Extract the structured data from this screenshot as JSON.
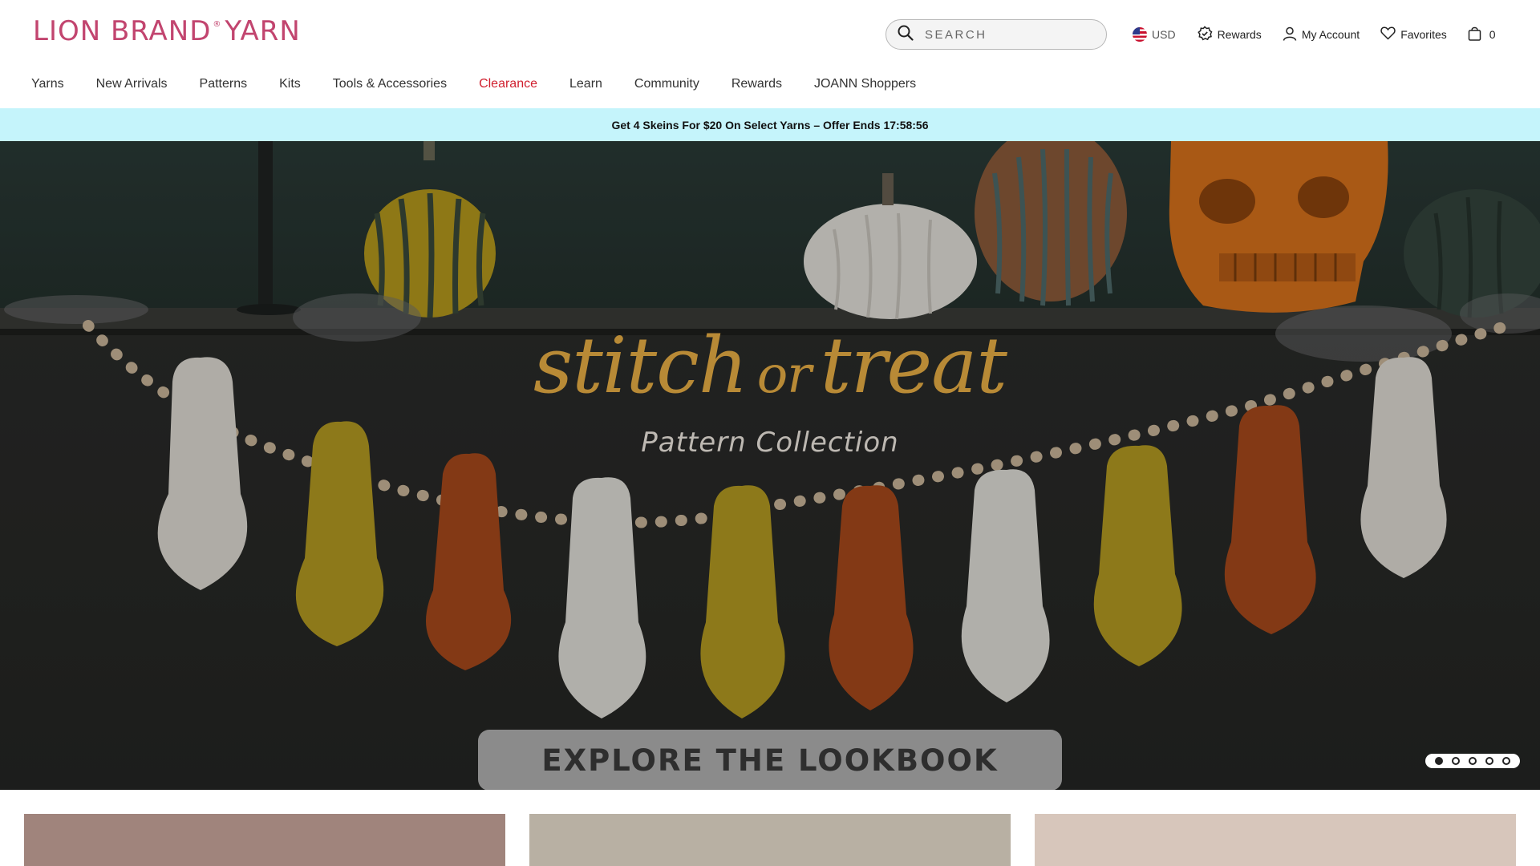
{
  "brand": {
    "logo_text": "LION BRAND",
    "logo_mark": "®",
    "logo_suffix": "YARN",
    "color": "#c2456f"
  },
  "search": {
    "placeholder": "SEARCH",
    "icon": "search-icon"
  },
  "utilities": {
    "currency": {
      "label": "USD",
      "icon": "us-flag-icon"
    },
    "rewards": {
      "label": "Rewards",
      "icon": "rewards-badge-icon"
    },
    "account": {
      "label": "My Account",
      "icon": "user-icon"
    },
    "favorites": {
      "label": "Favorites",
      "icon": "heart-icon"
    },
    "cart": {
      "count": "0",
      "icon": "shopping-bag-icon"
    }
  },
  "nav": {
    "items": [
      {
        "label": "Yarns"
      },
      {
        "label": "New Arrivals"
      },
      {
        "label": "Patterns"
      },
      {
        "label": "Kits"
      },
      {
        "label": "Tools & Accessories"
      },
      {
        "label": "Clearance",
        "color": "#d01f2e"
      },
      {
        "label": "Learn"
      },
      {
        "label": "Community"
      },
      {
        "label": "Rewards"
      },
      {
        "label": "JOANN Shoppers"
      }
    ]
  },
  "promo": {
    "text": "Get 4 Skeins For $20 On Select Yarns – Offer Ends 17:58:56",
    "background": "#c5f4fb"
  },
  "hero": {
    "title_part1": "stitch",
    "title_or": "or",
    "title_part2": "treat",
    "subtitle": "Pattern Collection",
    "cta_label": "EXPLORE THE LOOKBOOK",
    "title_color": "#b88a36",
    "slides_total": 5,
    "active_slide": 1
  },
  "cards": {
    "colors": [
      "#a0847c",
      "#b8b0a3",
      "#d7c6bb"
    ]
  }
}
